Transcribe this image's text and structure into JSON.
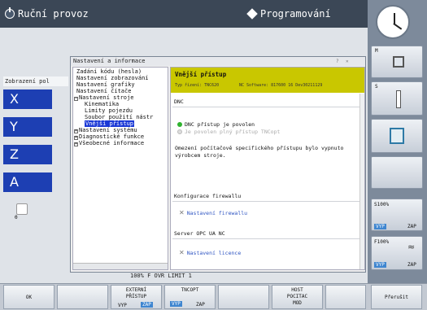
{
  "topbar": {
    "left_mode": "Ruční provoz",
    "right_mode": "Programování"
  },
  "background": {
    "view_label": "Zobrazení pol",
    "axes": [
      "X",
      "Y",
      "Z",
      "A"
    ],
    "feed_text": "100% F OVR   LIMIT 1",
    "position_text": "0"
  },
  "dialog": {
    "title": "Nastavení a informace",
    "tree": [
      {
        "label": "Zadání kódu (hesla)",
        "expander": ""
      },
      {
        "label": "Nastavení zobrazování",
        "expander": ""
      },
      {
        "label": "Nastavení grafiky",
        "expander": ""
      },
      {
        "label": "Nastavení čítače",
        "expander": ""
      },
      {
        "label": "Nastavení stroje",
        "expander": "−"
      },
      {
        "label": "Kinematika",
        "expander": ""
      },
      {
        "label": "Limity pojezdu",
        "expander": ""
      },
      {
        "label": "Soubor použití nástr",
        "expander": ""
      },
      {
        "label": "Vnější přístup",
        "expander": ""
      },
      {
        "label": "Nastavení systému",
        "expander": "+"
      },
      {
        "label": "Diagnostické funkce",
        "expander": "+"
      },
      {
        "label": "Všeobecné informace",
        "expander": "+"
      }
    ],
    "selected_index": 8,
    "content": {
      "header_title": "Vnější přístup",
      "device_type": "Typ řízení: TNC620",
      "nc_software": "NC Software: 817600 16 Dev30211129",
      "dnc_section": "DNC",
      "dnc_enabled": "DNC přístup je povolen",
      "tncopt_full": "Je povolen plný přístup TNCopt",
      "restriction_note": "Omezení počítačově specifického přístupu bylo vypnuto výrobcem stroje.",
      "firewall_section": "Konfigurace firewallu",
      "firewall_link": "Nastavení firewallu",
      "opc_section": "Server OPC UA NC",
      "license_link": "Nastavení licence"
    }
  },
  "right_panel": {
    "m_label": "M",
    "s_label": "S",
    "s100_label": "S100%",
    "f100_label": "F100%",
    "off_label": "VYP",
    "on_label": "ZAP"
  },
  "softkeys": {
    "ok": "OK",
    "external_access": [
      "EXTERNÍ",
      "PŘÍSTUP"
    ],
    "external_off": "VYP",
    "external_on": "ZAP",
    "tncopt": "TNCOPT",
    "tncopt_off": "VYP",
    "tncopt_on": "ZAP",
    "host_computer": [
      "HOST",
      "POCITAC"
    ],
    "host_mode": "MOD",
    "cancel": "Přerušit"
  },
  "colors": {
    "header_accent": "#c9c700",
    "selection": "#1b39d6",
    "axis_fill": "#1d3fb3",
    "toggle_on": "#3f86d0"
  }
}
